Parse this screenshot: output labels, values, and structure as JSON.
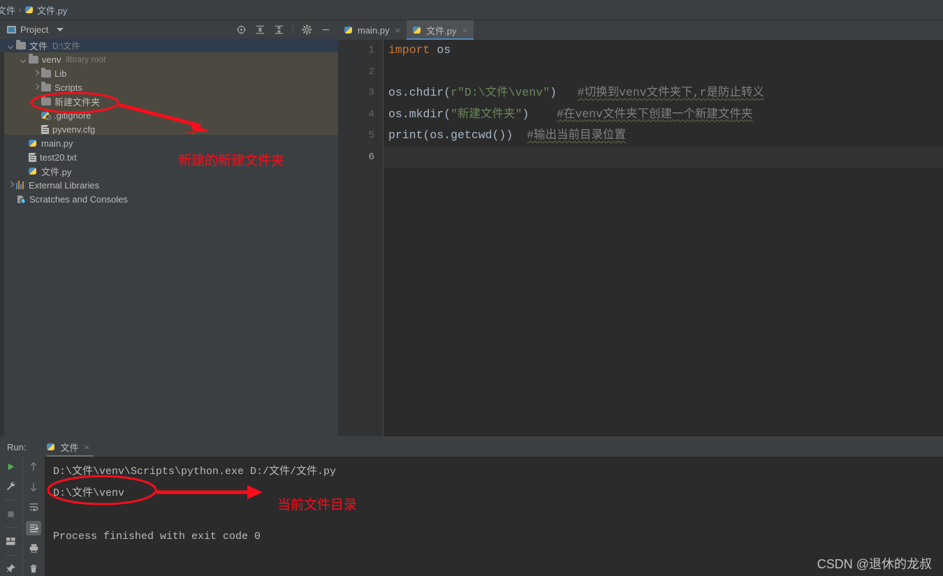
{
  "breadcrumb": {
    "root": "文件",
    "separator": "›",
    "file": "文件.py"
  },
  "project_panel": {
    "title": "Project",
    "tools": [
      "locate-target-icon",
      "expand-all-icon",
      "collapse-all-icon",
      "settings-gear-icon",
      "hide-panel-icon"
    ],
    "tree": [
      {
        "depth": 0,
        "arrow": "open",
        "icon": "folder-icon",
        "label": "文件",
        "sub": "D:\\文件",
        "selected": true
      },
      {
        "depth": 1,
        "arrow": "open",
        "icon": "folder-icon",
        "label": "venv",
        "sub": "library root",
        "selected": false
      },
      {
        "depth": 2,
        "arrow": "closed",
        "icon": "folder-icon",
        "label": "Lib",
        "sub": "",
        "selected": false
      },
      {
        "depth": 2,
        "arrow": "closed",
        "icon": "folder-icon",
        "label": "Scripts",
        "sub": "",
        "selected": false
      },
      {
        "depth": 2,
        "arrow": "none",
        "icon": "folder-icon",
        "label": "新建文件夹",
        "sub": "",
        "selected": false
      },
      {
        "depth": 2,
        "arrow": "none",
        "icon": "gitignore-icon",
        "label": ".gitignore",
        "sub": "",
        "selected": false
      },
      {
        "depth": 2,
        "arrow": "none",
        "icon": "file-icon",
        "label": "pyvenv.cfg",
        "sub": "",
        "selected": false
      },
      {
        "depth": 1,
        "arrow": "none",
        "icon": "python-icon",
        "label": "main.py",
        "sub": "",
        "selected": false
      },
      {
        "depth": 1,
        "arrow": "none",
        "icon": "file-icon",
        "label": "test20.txt",
        "sub": "",
        "selected": false
      },
      {
        "depth": 1,
        "arrow": "none",
        "icon": "python-icon",
        "label": "文件.py",
        "sub": "",
        "selected": false
      },
      {
        "depth": 0,
        "arrow": "closed",
        "icon": "libraries-icon",
        "label": "External Libraries",
        "sub": "",
        "selected": false
      },
      {
        "depth": 0,
        "arrow": "none",
        "icon": "scratches-icon",
        "label": "Scratches and Consoles",
        "sub": "",
        "selected": false
      }
    ]
  },
  "editor": {
    "tabs": [
      {
        "label": "main.py",
        "icon": "python-icon",
        "active": false,
        "close": "×"
      },
      {
        "label": "文件.py",
        "icon": "python-icon",
        "active": true,
        "close": "×"
      }
    ],
    "line_numbers": [
      "1",
      "2",
      "3",
      "4",
      "5",
      "6"
    ],
    "current_line": 6,
    "lines": [
      {
        "n": 1,
        "segments": [
          {
            "t": "import",
            "c": "kw"
          },
          {
            "t": " os",
            "c": "fn"
          }
        ]
      },
      {
        "n": 2,
        "segments": []
      },
      {
        "n": 3,
        "segments": [
          {
            "t": "os.chdir(",
            "c": "fn"
          },
          {
            "t": "r\"D:\\文件\\venv\"",
            "c": "str"
          },
          {
            "t": ")",
            "c": "fn"
          },
          {
            "t": "   ",
            "c": "fn"
          },
          {
            "t": "#切换到venv文件夹下,r是防止转义",
            "c": "cmt"
          }
        ]
      },
      {
        "n": 4,
        "segments": [
          {
            "t": "os.mkdir(",
            "c": "fn"
          },
          {
            "t": "\"新建文件夹\"",
            "c": "str"
          },
          {
            "t": ")",
            "c": "fn"
          },
          {
            "t": "    ",
            "c": "fn"
          },
          {
            "t": "#在venv文件夹下创建一个新建文件夹",
            "c": "cmt"
          }
        ]
      },
      {
        "n": 5,
        "segments": [
          {
            "t": "print",
            "c": "fn"
          },
          {
            "t": "(os.getcwd())",
            "c": "fn"
          },
          {
            "t": "  ",
            "c": "fn"
          },
          {
            "t": "#输出当前目录位置",
            "c": "cmt"
          }
        ]
      },
      {
        "n": 6,
        "segments": []
      }
    ]
  },
  "run_panel": {
    "label": "Run:",
    "tab": {
      "label": "文件",
      "icon": "python-icon",
      "close": "×"
    },
    "gutter_left": [
      "run-play-icon",
      "wrench-icon",
      "stop-icon",
      "layout-icon",
      "pin-icon"
    ],
    "gutter_right": [
      "arrow-up-icon",
      "arrow-down-icon",
      "soft-wrap-icon",
      "scroll-to-end-icon",
      "print-icon",
      "trash-icon"
    ],
    "active_gutter_icon": "scroll-to-end-icon",
    "console_lines": [
      "D:\\文件\\venv\\Scripts\\python.exe D:/文件/文件.py",
      "D:\\文件\\venv",
      "",
      "Process finished with exit code 0"
    ]
  },
  "annotations": {
    "color": "#fc0d1b",
    "tree_note": "新建的新建文件夹",
    "console_note": "当前文件目录"
  },
  "watermark": "CSDN @退休的龙叔"
}
